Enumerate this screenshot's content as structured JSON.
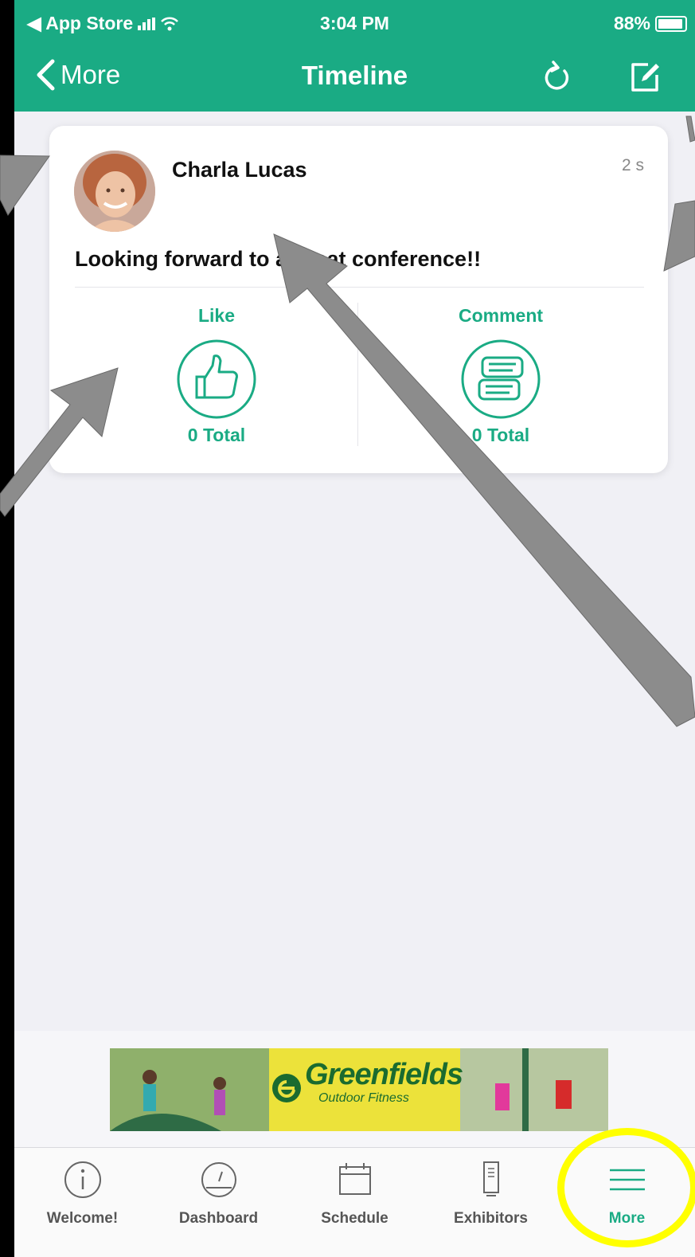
{
  "status_bar": {
    "carrier": "◀ App Store",
    "time": "3:04 PM",
    "battery": "88%"
  },
  "nav": {
    "back_label": "More",
    "title": "Timeline"
  },
  "post": {
    "author": "Charla Lucas",
    "time": "2 s",
    "text": "Looking forward to a great conference!!",
    "like_label": "Like",
    "like_count": "0 Total",
    "comment_label": "Comment",
    "comment_count": "0 Total"
  },
  "ad": {
    "brand": "Greenfields",
    "tagline": "Outdoor Fitness"
  },
  "tabs": [
    {
      "label": "Welcome!",
      "icon": "info-icon"
    },
    {
      "label": "Dashboard",
      "icon": "dashboard-icon"
    },
    {
      "label": "Schedule",
      "icon": "calendar-icon"
    },
    {
      "label": "Exhibitors",
      "icon": "booth-icon"
    },
    {
      "label": "More",
      "icon": "menu-icon",
      "active": true
    }
  ],
  "colors": {
    "accent": "#1aab84",
    "highlight": "#ffff00"
  }
}
